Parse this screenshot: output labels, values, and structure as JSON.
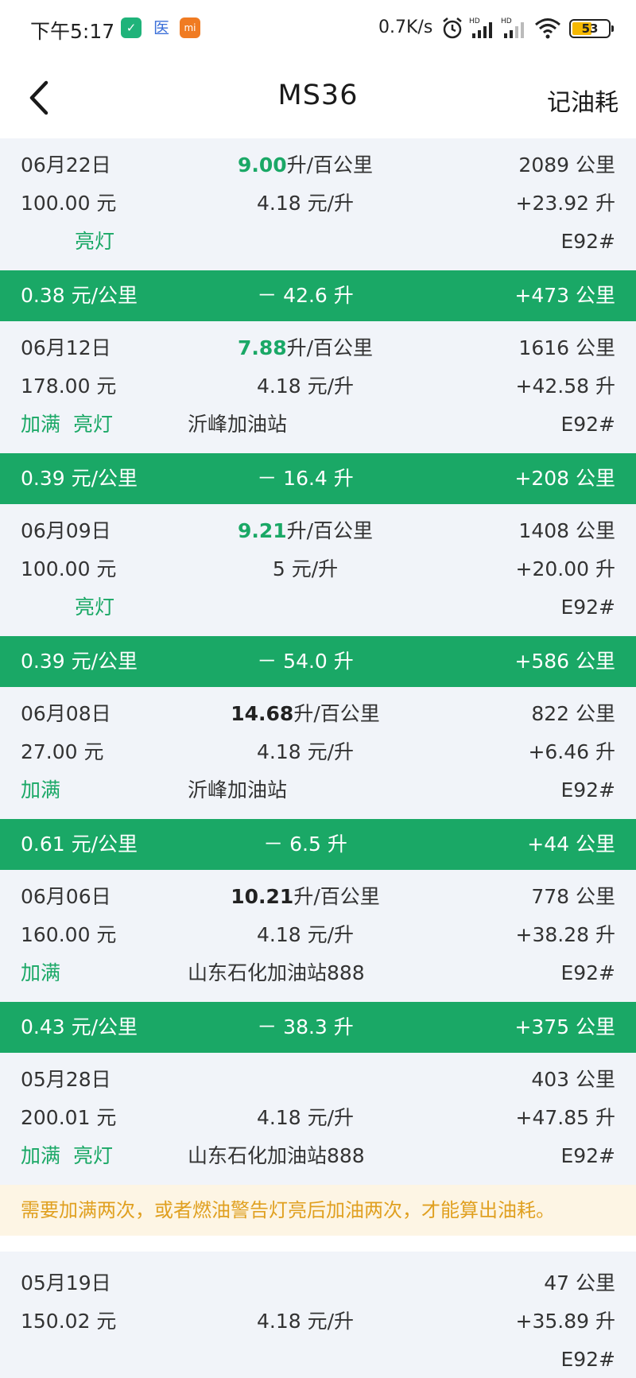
{
  "status_bar": {
    "time": "下午5:17",
    "app_icon_2": "医",
    "app_icon_3": "mi",
    "speed": "0.7K/s",
    "battery": "53",
    "battery_color": "#f5b800"
  },
  "header": {
    "title": "MS36",
    "action": "记油耗",
    "back_icon": "chevron-left-icon"
  },
  "colors": {
    "accent": "#1aa866",
    "record_bg": "#f1f4f9",
    "warning_text": "#e0a020",
    "warning_bg": "#fdf5e4"
  },
  "records": [
    {
      "date": "06月22日",
      "consumption": "9.00",
      "cons_unit": "升/百公里",
      "odometer": "2089 公里",
      "amount": "100.00 元",
      "price": "4.18 元/升",
      "liters": "+23.92 升",
      "tag1": "",
      "tag2": "亮灯",
      "station": "",
      "fuel": "E92#"
    },
    {
      "date": "06月12日",
      "consumption": "7.88",
      "cons_unit": "升/百公里",
      "odometer": "1616 公里",
      "amount": "178.00 元",
      "price": "4.18 元/升",
      "liters": "+42.58 升",
      "tag1": "加满",
      "tag2": "亮灯",
      "station": "沂峰加油站",
      "fuel": "E92#"
    },
    {
      "date": "06月09日",
      "consumption": "9.21",
      "cons_unit": "升/百公里",
      "odometer": "1408 公里",
      "amount": "100.00 元",
      "price": "5 元/升",
      "liters": "+20.00 升",
      "tag1": "",
      "tag2": "亮灯",
      "station": "",
      "fuel": "E92#"
    },
    {
      "date": "06月08日",
      "consumption": "14.68",
      "cons_unit": "升/百公里",
      "odometer": "822 公里",
      "amount": "27.00 元",
      "price": "4.18 元/升",
      "liters": "+6.46 升",
      "tag1": "加满",
      "tag2": "",
      "station": "沂峰加油站",
      "fuel": "E92#"
    },
    {
      "date": "06月06日",
      "consumption": "10.21",
      "cons_unit": "升/百公里",
      "odometer": "778 公里",
      "amount": "160.00 元",
      "price": "4.18 元/升",
      "liters": "+38.28 升",
      "tag1": "加满",
      "tag2": "",
      "station": "山东石化加油站888",
      "fuel": "E92#"
    },
    {
      "date": "05月28日",
      "consumption": "",
      "cons_unit": "",
      "odometer": "403 公里",
      "amount": "200.01 元",
      "price": "4.18 元/升",
      "liters": "+47.85 升",
      "tag1": "加满",
      "tag2": "亮灯",
      "station": "山东石化加油站888",
      "fuel": "E92#"
    },
    {
      "date": "05月19日",
      "consumption": "",
      "cons_unit": "",
      "odometer": "47 公里",
      "amount": "150.02 元",
      "price": "4.18 元/升",
      "liters": "+35.89 升",
      "tag1": "",
      "tag2": "",
      "station": "",
      "fuel": "E92#"
    }
  ],
  "summaries": [
    {
      "cost_per_km": "0.38 元/公里",
      "fuel_used": "－ 42.6 升",
      "distance": "+473 公里"
    },
    {
      "cost_per_km": "0.39 元/公里",
      "fuel_used": "－ 16.4 升",
      "distance": "+208 公里"
    },
    {
      "cost_per_km": "0.39 元/公里",
      "fuel_used": "－ 54.0 升",
      "distance": "+586 公里"
    },
    {
      "cost_per_km": "0.61 元/公里",
      "fuel_used": "－ 6.5 升",
      "distance": "+44 公里"
    },
    {
      "cost_per_km": "0.43 元/公里",
      "fuel_used": "－ 38.3 升",
      "distance": "+375 公里"
    }
  ],
  "warning": "需要加满两次，或者燃油警告灯亮后加油两次，才能算出油耗。"
}
